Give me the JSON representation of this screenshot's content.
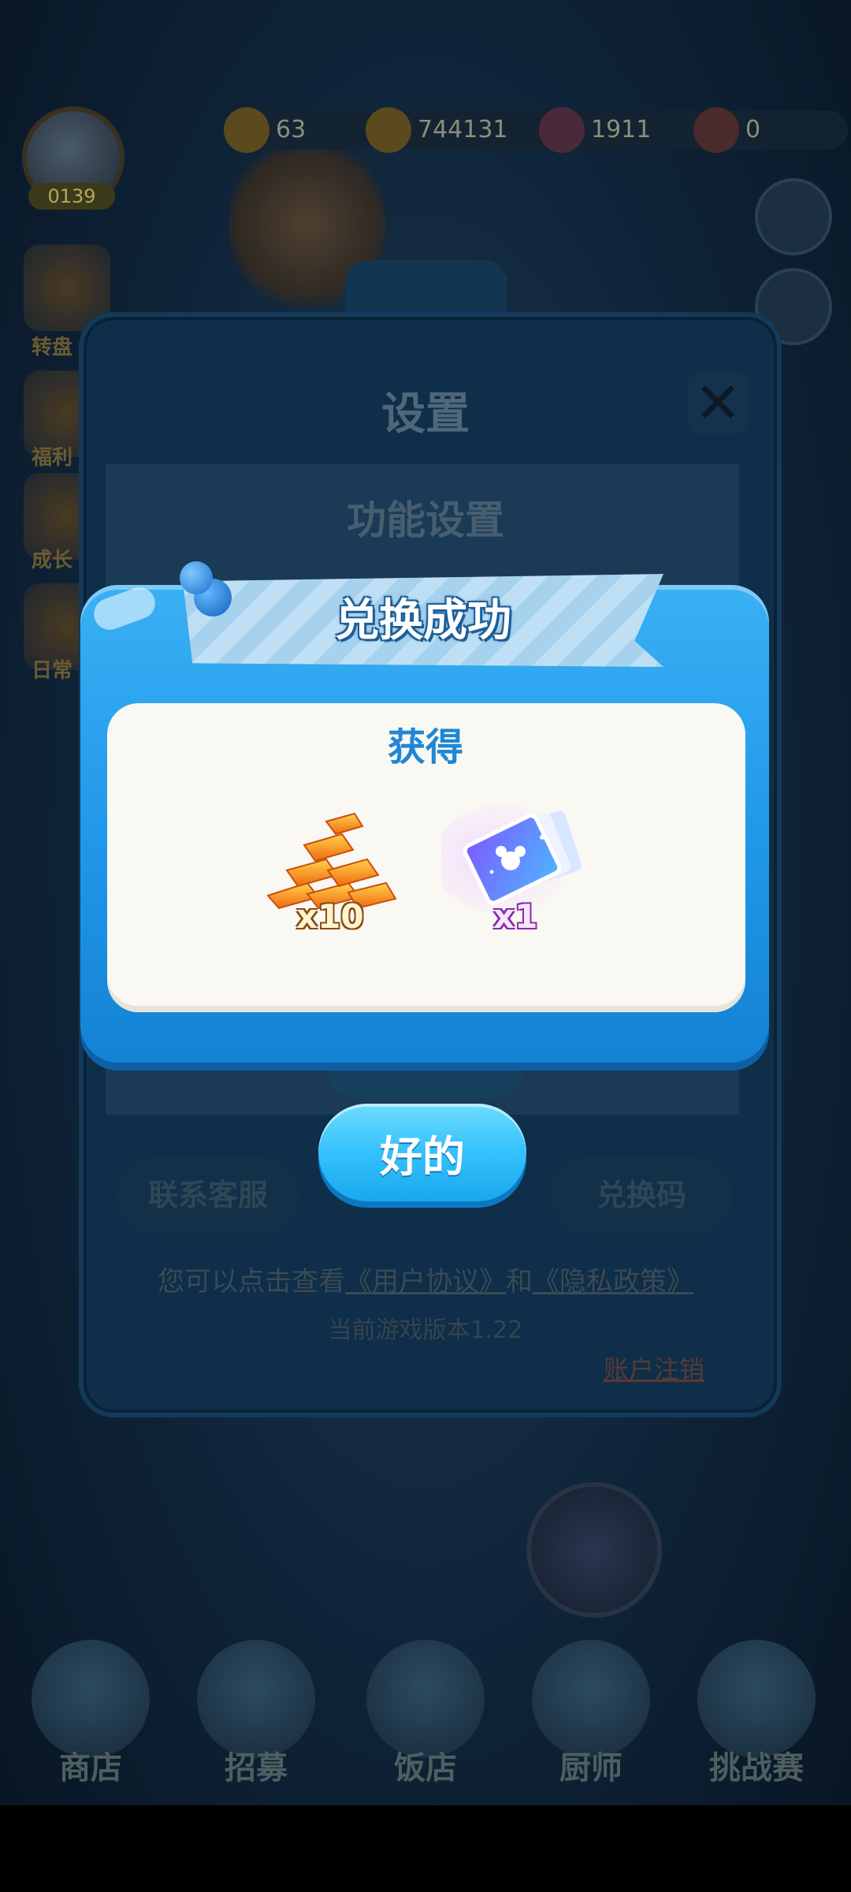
{
  "hud": {
    "level": "0139",
    "resources": [
      "63",
      "744131",
      "1911",
      "0"
    ]
  },
  "left_labels": [
    "转盘",
    "福利",
    "成长",
    "日常"
  ],
  "bottom_nav": [
    "商店",
    "招募",
    "饭店",
    "厨师",
    "挑战赛"
  ],
  "settings": {
    "title": "设置",
    "section": "功能设置",
    "close_icon": "close-x",
    "buttons": [
      "联系客服",
      "兑换码"
    ],
    "agreement_prefix": "您可以点击查看",
    "user_agreement": "《用户协议》",
    "and": "和",
    "privacy_policy": "《隐私政策》",
    "version": "当前游戏版本1.22",
    "logout": "账户注销"
  },
  "dialog": {
    "title": "兑换成功",
    "subtitle": "获得",
    "rewards": [
      {
        "icon": "gold-bars-icon",
        "quantity": "x10"
      },
      {
        "icon": "photo-cards-icon",
        "quantity": "x1"
      }
    ],
    "ok_button": "好的"
  },
  "colors": {
    "dialog_blue": "#1f97e9",
    "ok_button": "#34c1fb",
    "subtitle_blue": "#1f86d6"
  }
}
